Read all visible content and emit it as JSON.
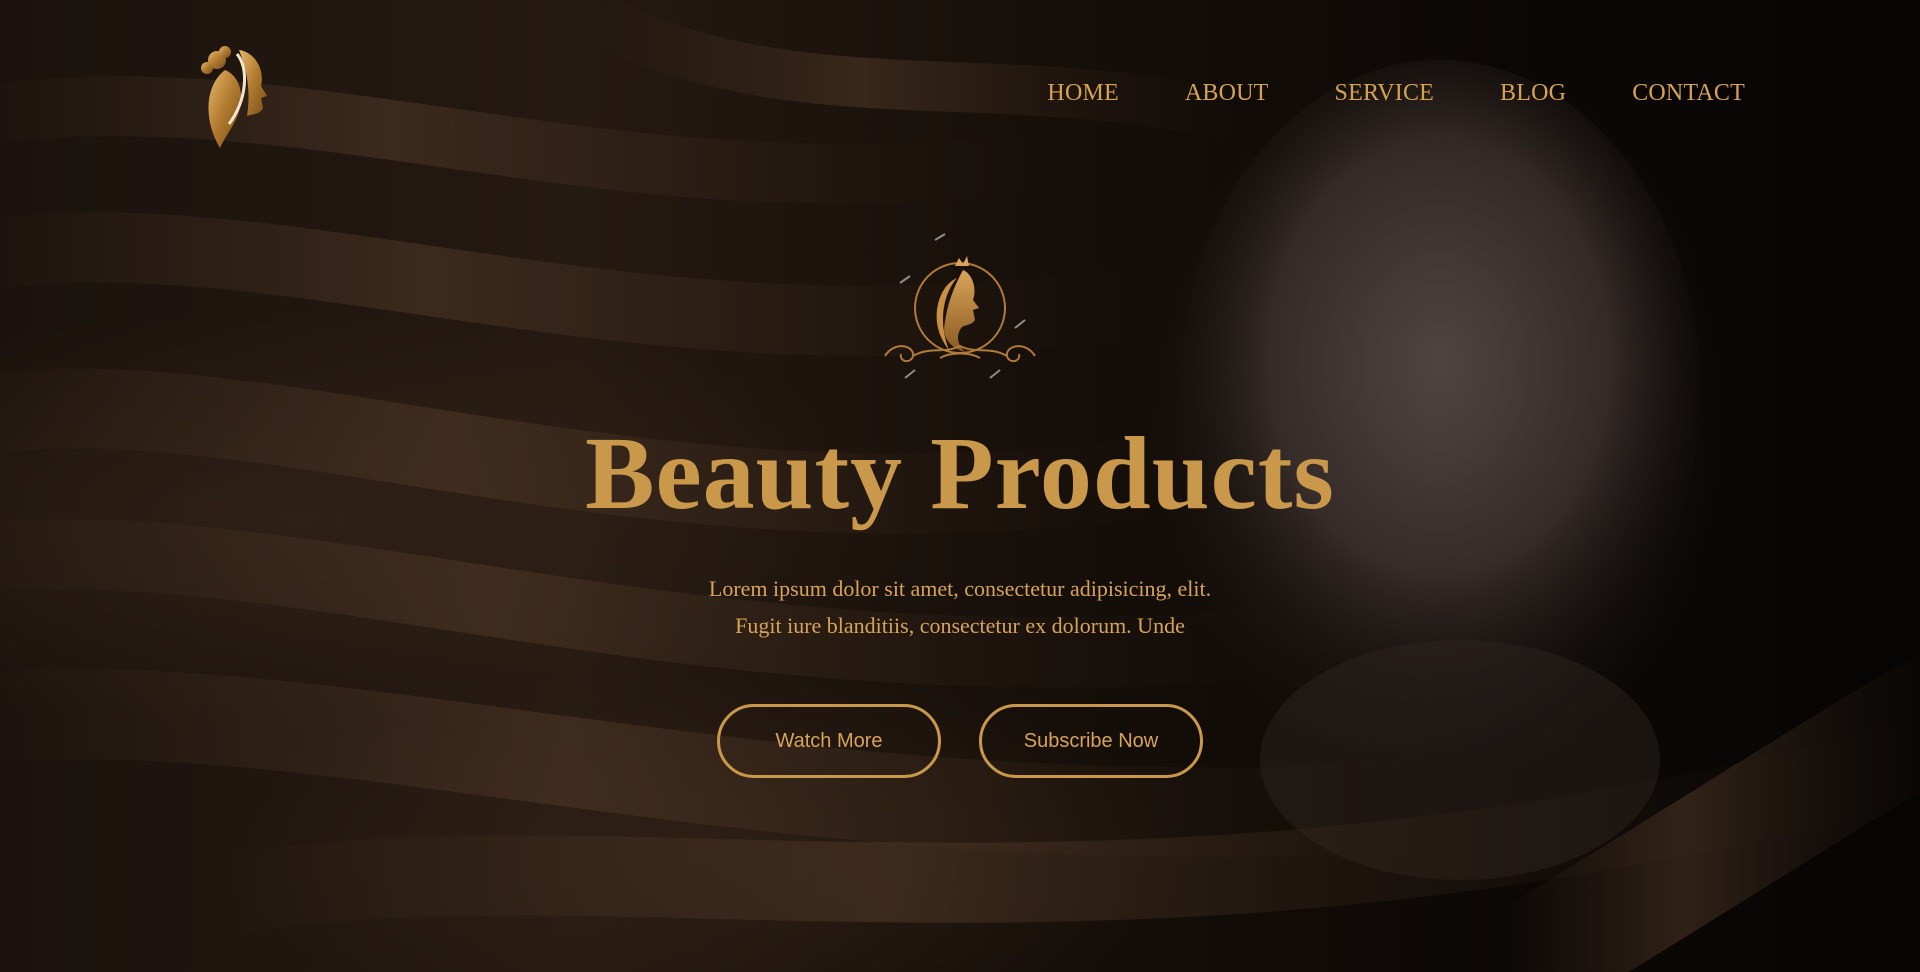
{
  "nav": {
    "items": [
      {
        "label": "HOME"
      },
      {
        "label": "ABOUT"
      },
      {
        "label": "SERVICE"
      },
      {
        "label": "BLOG"
      },
      {
        "label": "CONTACT"
      }
    ]
  },
  "hero": {
    "title": "Beauty Products",
    "subtitle_line1": "Lorem ipsum dolor sit amet, consectetur adipisicing, elit.",
    "subtitle_line2": "Fugit iure blanditiis, consectetur ex dolorum. Unde",
    "watch_button": "Watch More",
    "subscribe_button": "Subscribe Now"
  },
  "icons": {
    "logo": "woman-profile-logo-icon",
    "emblem": "crowned-woman-emblem-icon"
  },
  "colors": {
    "accent": "#c9984a",
    "text_gold": "#d6a35a",
    "background": "#0b0807"
  }
}
